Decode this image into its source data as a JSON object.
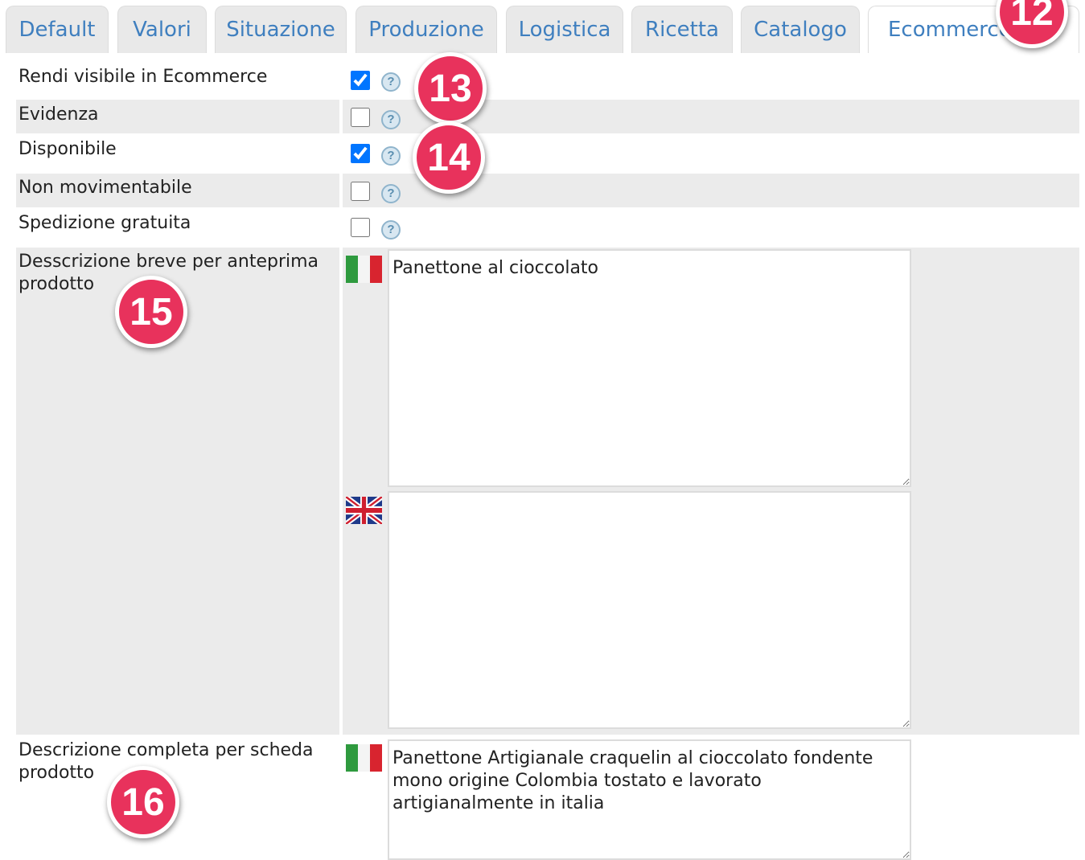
{
  "tabs": [
    {
      "label": "Default"
    },
    {
      "label": "Valori"
    },
    {
      "label": "Situazione"
    },
    {
      "label": "Produzione"
    },
    {
      "label": "Logistica"
    },
    {
      "label": "Ricetta"
    },
    {
      "label": "Catalogo"
    },
    {
      "label": "Ecommerce"
    }
  ],
  "badges": [
    "12",
    "13",
    "14",
    "15",
    "16"
  ],
  "fields": {
    "rendi_visibile": {
      "label": "Rendi visibile in Ecommerce",
      "checked": true
    },
    "evidenza": {
      "label": "Evidenza",
      "checked": false
    },
    "disponibile": {
      "label": "Disponibile",
      "checked": true
    },
    "non_movimentabile": {
      "label": "Non movimentabile",
      "checked": false
    },
    "spedizione_gratuita": {
      "label": "Spedizione gratuita",
      "checked": false
    },
    "help_glyph": "?",
    "descrizione_breve": {
      "label": "Desscrizione breve per anteprima prodotto",
      "value_it": "Panettone al cioccolato",
      "value_en": ""
    },
    "descrizione_completa": {
      "label": "Descrizione completa per scheda prodotto",
      "value_it": "Panettone Artigianale craquelin al cioccolato fondente mono origine Colombia tostato e lavorato artigianalmente in italia"
    }
  },
  "colors": {
    "accent": "#3f7fbf",
    "badge": "#e8325c",
    "row_shade": "#ebebeb",
    "tab_bg": "#e9e9e9"
  },
  "icons": [
    "help-icon",
    "italy-flag-icon",
    "uk-flag-icon",
    "checkbox"
  ]
}
